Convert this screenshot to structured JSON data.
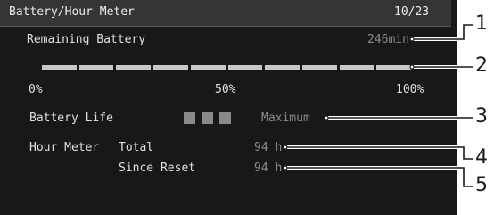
{
  "header": {
    "title": "Battery/Hour Meter",
    "page": "10/23"
  },
  "remaining_battery": {
    "label": "Remaining Battery",
    "value": "246min",
    "level_fraction": 1.0,
    "segments": 10
  },
  "scale": {
    "min": "0%",
    "mid": "50%",
    "max": "100%"
  },
  "battery_life": {
    "label": "Battery Life",
    "boxes_filled": 3,
    "boxes_total": 3,
    "value": "Maximum"
  },
  "hour_meter": {
    "label": "Hour Meter",
    "total_label": "Total",
    "total_value": "94 h",
    "reset_label": "Since Reset",
    "reset_value": "94 h"
  },
  "callouts": [
    "1",
    "2",
    "3",
    "4",
    "5"
  ],
  "colors": {
    "screen_bg": "#181818",
    "title_bg": "#353535",
    "bar_fill": "#c8c8c8",
    "value_text": "#8c8c8c"
  }
}
